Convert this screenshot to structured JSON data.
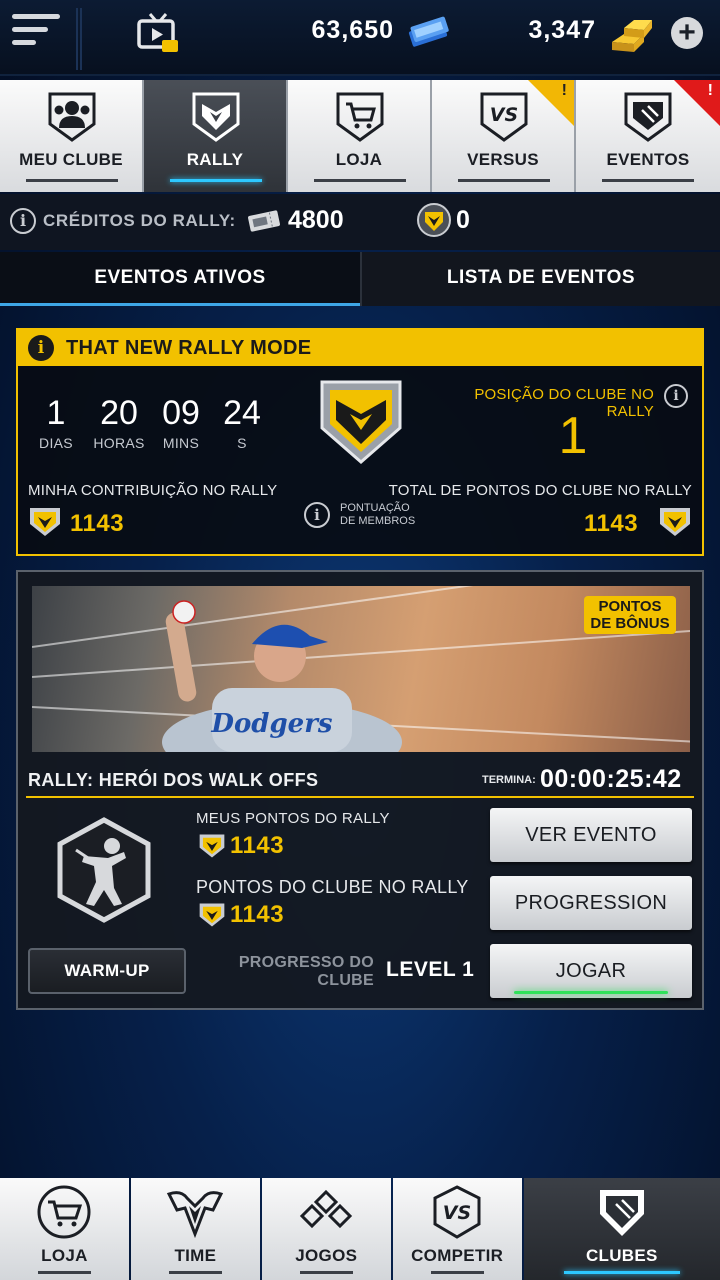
{
  "topbar": {
    "stubs": "63,650",
    "gold": "3,347",
    "add_symbol": "+",
    "icons": [
      "menu-icon",
      "tv-icon",
      "stubs-icon",
      "gold-bars-icon",
      "plus-icon"
    ]
  },
  "nav": {
    "tabs": [
      {
        "label": "MEU CLUBE",
        "icon": "club-members-icon"
      },
      {
        "label": "RALLY",
        "icon": "rally-shield-icon",
        "active": true
      },
      {
        "label": "LOJA",
        "icon": "cart-shield-icon"
      },
      {
        "label": "VERSUS",
        "icon": "versus-shield-icon",
        "alert": "!"
      },
      {
        "label": "EVENTOS",
        "icon": "events-shield-icon",
        "alert": "!"
      }
    ]
  },
  "credits": {
    "label": "CRÉDITOS DO RALLY:",
    "value": "4800",
    "badge_value": "0"
  },
  "subtabs": {
    "active": "EVENTOS ATIVOS",
    "other": "LISTA DE EVENTOS"
  },
  "rally": {
    "title": "THAT NEW RALLY MODE",
    "timer": {
      "days": "1",
      "days_label": "DIAS",
      "hours": "20",
      "hours_label": "HORAS",
      "mins": "09",
      "mins_label": "MINS",
      "secs": "24",
      "secs_label": "S"
    },
    "position_label": "POSIÇÃO DO CLUBE NO RALLY",
    "position_value": "1",
    "contribution_label": "MINHA CONTRIBUIÇÃO NO RALLY",
    "contribution_value": "1143",
    "member_scoring_line1": "PONTUAÇÃO",
    "member_scoring_line2": "DE MEMBROS",
    "club_total_label": "TOTAL DE PONTOS DO CLUBE NO RALLY",
    "club_total_value": "1143"
  },
  "event": {
    "bonus_line1": "PONTOS",
    "bonus_line2": "DE BÔNUS",
    "jersey_text": "Dodgers",
    "title": "RALLY: HERÓI DOS WALK OFFS",
    "ends_label": "TERMINA:",
    "ends_value": "00:00:25:42",
    "my_points_label": "MEUS PONTOS DO RALLY",
    "my_points_value": "1143",
    "club_points_label": "PONTOS DO CLUBE NO RALLY",
    "club_points_value": "1143",
    "view_button": "VER EVENTO",
    "progression_button": "PROGRESSION",
    "play_button": "JOGAR",
    "warmup_button": "WARM-UP",
    "progress_line1": "PROGRESSO DO",
    "progress_line2": "CLUBE",
    "level_value": "LEVEL 1"
  },
  "bottomnav": {
    "tabs": [
      {
        "label": "LOJA",
        "icon": "cart-icon"
      },
      {
        "label": "TIME",
        "icon": "team-wings-icon"
      },
      {
        "label": "JOGOS",
        "icon": "diamonds-icon"
      },
      {
        "label": "COMPETIR",
        "icon": "versus-icon"
      },
      {
        "label": "CLUBES",
        "icon": "home-plate-icon",
        "active": true
      }
    ]
  },
  "colors": {
    "accent_gold": "#f2c100",
    "accent_blue": "#2dc8ff",
    "alert_red": "#e01a1a",
    "glow_green": "#2fe25a"
  }
}
